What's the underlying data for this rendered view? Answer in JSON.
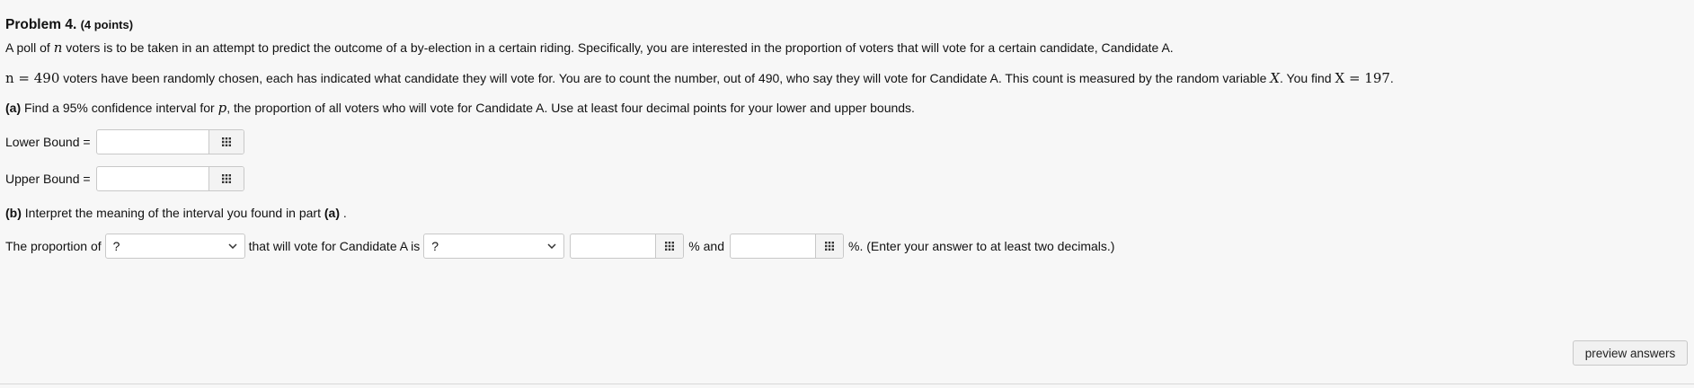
{
  "problem": {
    "title": "Problem 4.",
    "points": "(4 points)"
  },
  "intro": {
    "part1": "A poll of ",
    "var_n": "n",
    "part2": " voters is to be taken in an attempt to predict the outcome of a by-election in a certain riding. Specifically, you are interested in the proportion of voters that will vote for a certain candidate, Candidate A."
  },
  "setup": {
    "n_eq": "n = 490",
    "part1": " voters have been randomly chosen, each has indicated what candidate they will vote for. You are to count the number, out of 490, who say they will vote for Candidate A. This count is measured by the random variable ",
    "var_X": "X",
    "part2": ". You find ",
    "x_eq": "X = 197",
    "end": "."
  },
  "part_a": {
    "label": "(a)",
    "part1": " Find a 95% confidence interval for ",
    "var_p": "p",
    "part2": ", the proportion of all voters who will vote for Candidate A. Use at least four decimal points for your lower and upper bounds."
  },
  "lower": {
    "label": "Lower Bound =",
    "value": ""
  },
  "upper": {
    "label": "Upper Bound =",
    "value": ""
  },
  "part_b": {
    "label": "(b)",
    "text": " Interpret the meaning of the interval you found in part ",
    "ref": "(a)",
    "end": " ."
  },
  "interpret": {
    "prefix": "The proportion of",
    "select1": "?",
    "middle": "that will vote for Candidate A is",
    "select2": "?",
    "input1": "",
    "and_text": "% and",
    "input2": "",
    "suffix": "%. (Enter your answer to at least two decimals.)"
  },
  "buttons": {
    "preview": "preview answers"
  },
  "icons": {
    "grid": "keypad-grid-icon",
    "chevron": "chevron-down-icon"
  }
}
